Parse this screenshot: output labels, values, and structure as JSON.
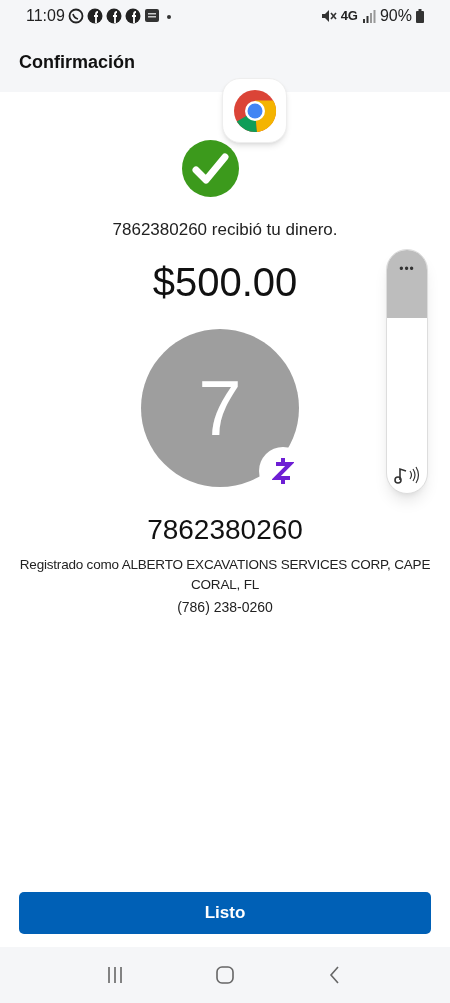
{
  "status_bar": {
    "time": "11:09",
    "network": "4G",
    "battery": "90%"
  },
  "header": {
    "title": "Confirmación"
  },
  "confirmation": {
    "message": "7862380260 recibió tu dinero.",
    "amount": "$500.00"
  },
  "recipient": {
    "avatar_initial": "7",
    "name": "7862380260",
    "registered_as": "Registrado como ALBERTO EXCAVATIONS SERVICES CORP, CAPE CORAL, FL",
    "phone": "(786) 238-0260"
  },
  "volume_panel": {
    "menu": "•••",
    "level": 0.67
  },
  "done_button": {
    "label": "Listo"
  }
}
